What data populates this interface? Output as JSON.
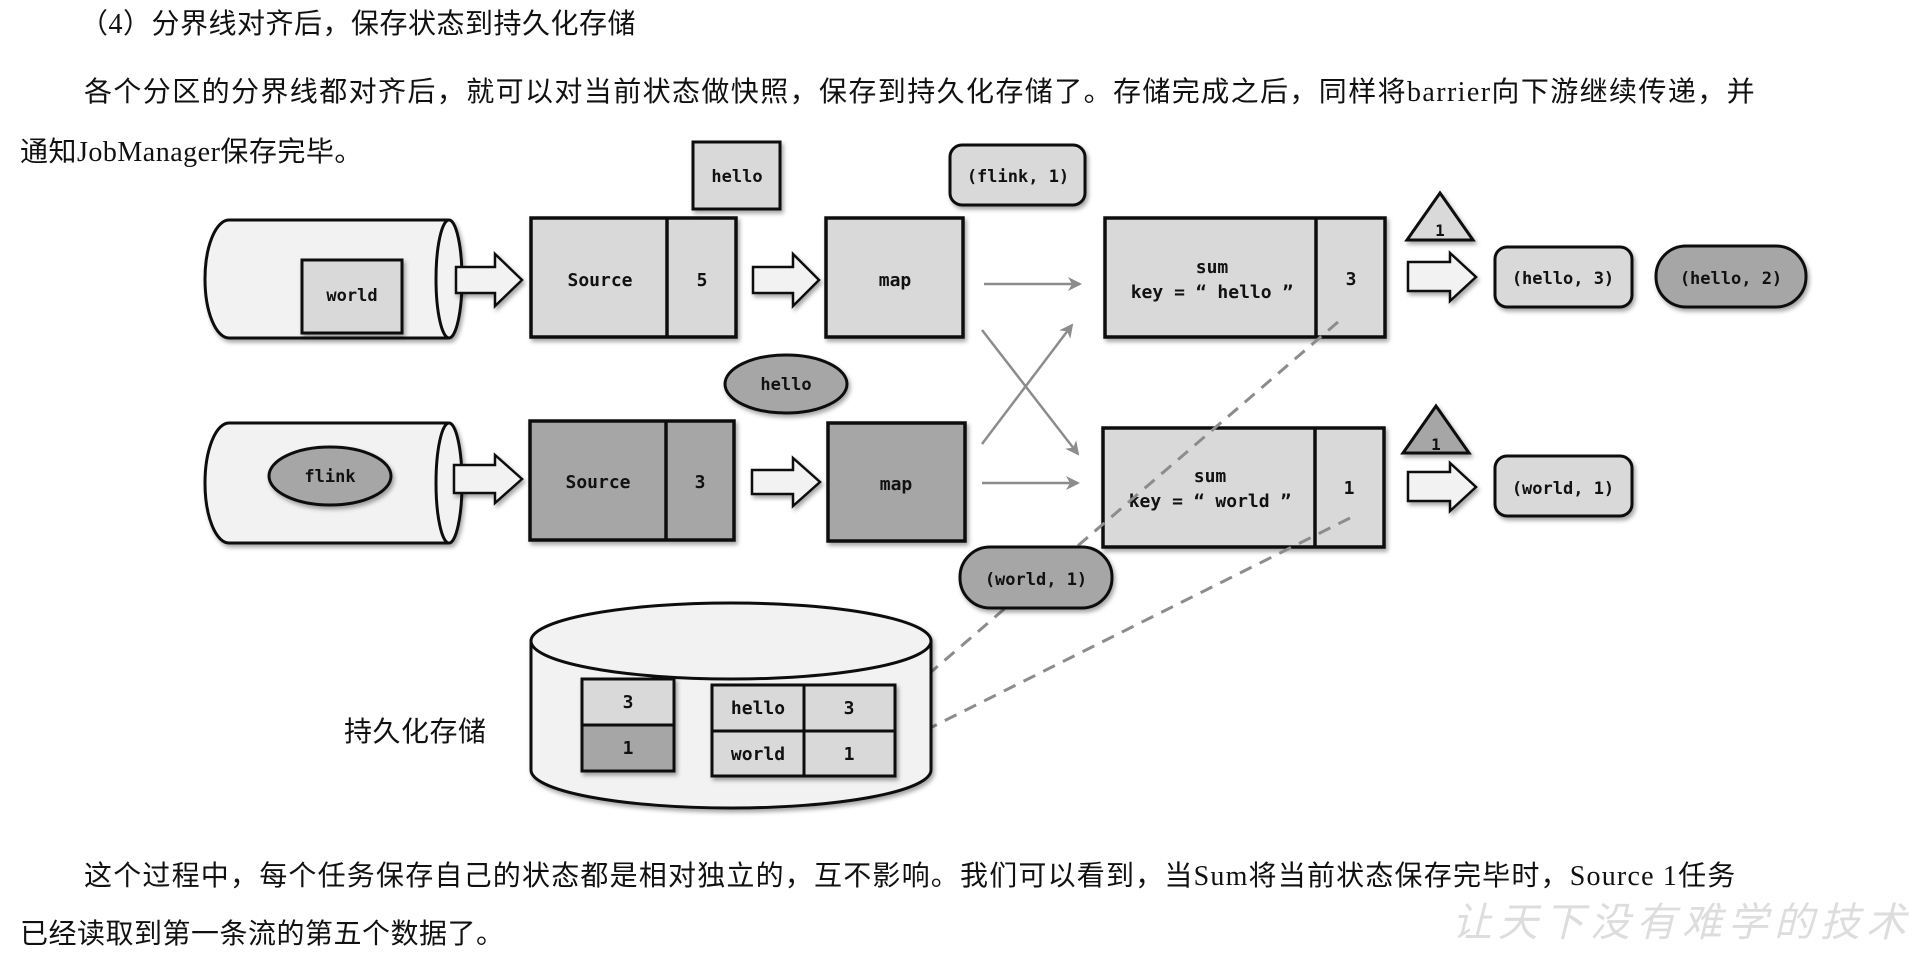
{
  "document": {
    "heading": "（4）分界线对齐后，保存状态到持久化存储",
    "paragraph1": {
      "line1": "各个分区的分界线都对齐后，就可以对当前状态做快照，保存到持久化存储了。存储完成之后，同样将barrier向下游继续传递，并",
      "line2": "通知JobManager保存完毕。"
    },
    "paragraph2": {
      "line1": "这个过程中，每个任务保存自己的状态都是相对独立的，互不影响。我们可以看到，当Sum将当前状态保存完毕时，Source 1任务",
      "line2": "已经读取到第一条流的第五个数据了。"
    },
    "watermark": "让天下没有难学的技术"
  },
  "diagram": {
    "colors": {
      "light_fill": "#d9d9d9",
      "dark_fill": "#a6a6a6",
      "cylinder_fill": "#f2f2f2",
      "stroke": "#111111",
      "arrow_gray": "#8c8c8c"
    },
    "row1": {
      "stream_item": "world",
      "source_label": "Source",
      "source_state": "5",
      "in_flight_to_map": "hello",
      "map_label": "map",
      "in_flight_to_sum": "(flink, 1)",
      "sum_label": "sum",
      "sum_key": "key = “ hello ”",
      "sum_state": "3",
      "barrier": "1",
      "output_1": "(hello, 3)",
      "output_2": "(hello, 2)"
    },
    "row2": {
      "stream_item": "flink",
      "source_label": "Source",
      "source_state": "3",
      "in_flight_to_map": "hello",
      "map_label": "map",
      "in_flight_to_sum": "(world, 1)",
      "sum_label": "sum",
      "sum_key": "key = “ world ”",
      "sum_state": "1",
      "barrier": "1",
      "output_1": "(world, 1)"
    },
    "storage": {
      "label": "持久化存储",
      "source_states": [
        "3",
        "1"
      ],
      "sum_states": [
        {
          "key": "hello",
          "value": "3"
        },
        {
          "key": "world",
          "value": "1"
        }
      ]
    }
  }
}
